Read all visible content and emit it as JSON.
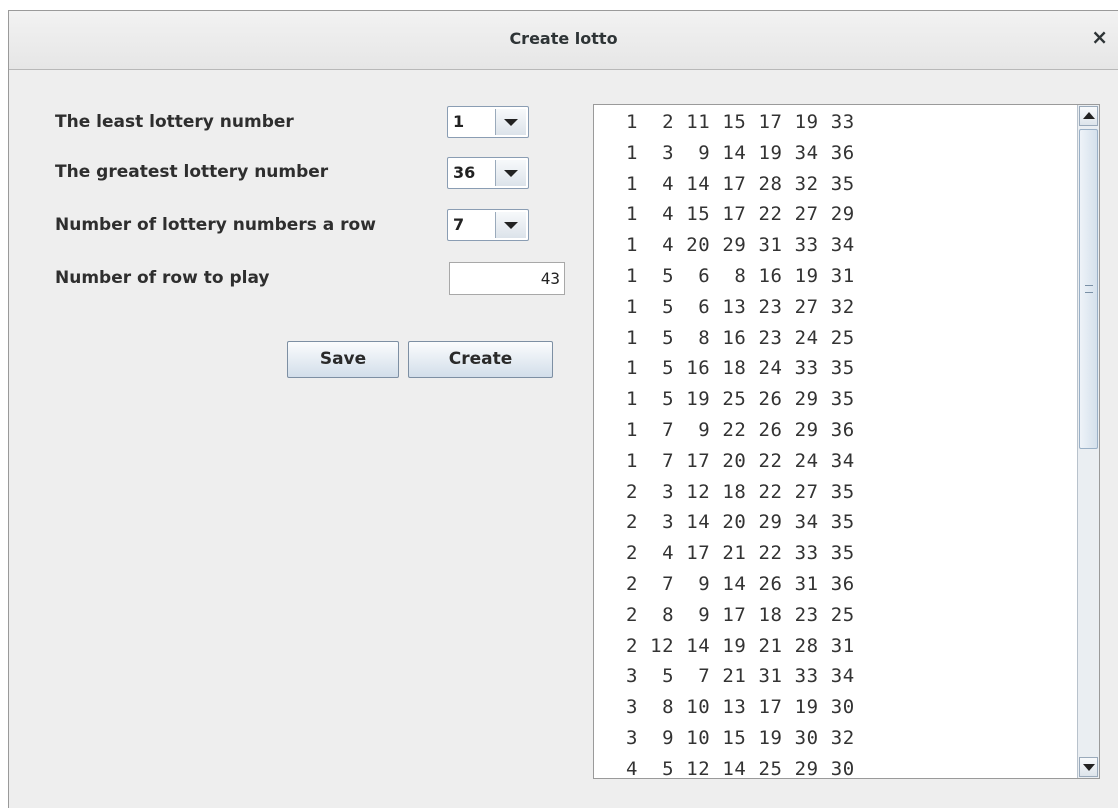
{
  "window": {
    "title": "Create lotto",
    "close_icon": "×"
  },
  "form": {
    "least_label": "The least lottery number",
    "least_value": "1",
    "greatest_label": "The greatest lottery number",
    "greatest_value": "36",
    "per_row_label": "Number of lottery numbers a row",
    "per_row_value": "7",
    "rows_label": "Number of row to play",
    "rows_value": "43"
  },
  "buttons": {
    "save": "Save",
    "create": "Create"
  },
  "rows": [
    " 1  2 11 15 17 19 33",
    " 1  3  9 14 19 34 36",
    " 1  4 14 17 28 32 35",
    " 1  4 15 17 22 27 29",
    " 1  4 20 29 31 33 34",
    " 1  5  6  8 16 19 31",
    " 1  5  6 13 23 27 32",
    " 1  5  8 16 23 24 25",
    " 1  5 16 18 24 33 35",
    " 1  5 19 25 26 29 35",
    " 1  7  9 22 26 29 36",
    " 1  7 17 20 22 24 34",
    " 2  3 12 18 22 27 35",
    " 2  3 14 20 29 34 35",
    " 2  4 17 21 22 33 35",
    " 2  7  9 14 26 31 36",
    " 2  8  9 17 18 23 25",
    " 2 12 14 19 21 28 31",
    " 3  5  7 21 31 33 34",
    " 3  8 10 13 17 19 30",
    " 3  9 10 15 19 30 32",
    " 4  5 12 14 25 29 30"
  ]
}
